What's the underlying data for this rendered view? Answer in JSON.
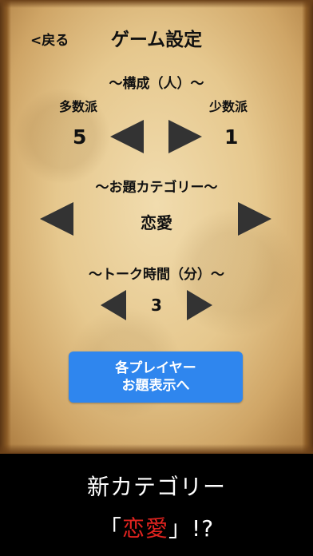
{
  "header": {
    "back_label": "<戻る",
    "title": "ゲーム設定"
  },
  "composition": {
    "heading": "〜構成（人）〜",
    "majority_label": "多数派",
    "minority_label": "少数派",
    "majority_value": "5",
    "minority_value": "1"
  },
  "category": {
    "heading": "〜お題カテゴリー〜",
    "value": "恋愛"
  },
  "talk_time": {
    "heading": "〜トーク時間（分）〜",
    "value": "3"
  },
  "action_button": {
    "line1": "各プレイヤー",
    "line2": "お題表示へ"
  },
  "banner": {
    "line1": "新カテゴリー",
    "line2_open": "「",
    "line2_highlight": "恋愛",
    "line2_close": "」!?"
  },
  "colors": {
    "button": "#2f86ee",
    "highlight": "#e0231f",
    "arrow": "#333333"
  }
}
